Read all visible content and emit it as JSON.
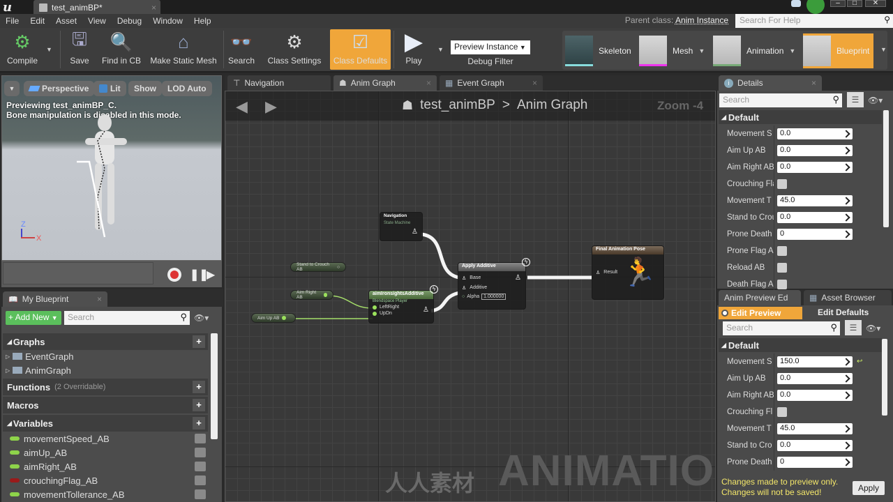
{
  "window": {
    "doc_tab": "test_animBP*",
    "parent_class_label": "Parent class:",
    "parent_class_value": "Anim Instance",
    "help_search_placeholder": "Search For Help"
  },
  "menu": [
    "File",
    "Edit",
    "Asset",
    "View",
    "Debug",
    "Window",
    "Help"
  ],
  "toolbar": {
    "compile": "Compile",
    "save": "Save",
    "find_in_cb": "Find in CB",
    "make_static_mesh": "Make Static Mesh",
    "search": "Search",
    "class_settings": "Class Settings",
    "class_defaults": "Class Defaults",
    "play": "Play",
    "debug_select": "Preview Instance",
    "debug_filter": "Debug Filter"
  },
  "asset_modes": [
    "Skeleton",
    "Mesh",
    "Animation",
    "Blueprint"
  ],
  "viewport": {
    "buttons": [
      "Perspective",
      "Lit",
      "Show",
      "LOD Auto"
    ],
    "info_line1": "Previewing test_animBP_C.",
    "info_line2": "Bone manipulation is disabled in this mode.",
    "axis_z": "Z",
    "axis_x": "X"
  },
  "my_blueprint": {
    "tab": "My Blueprint",
    "add_new": "Add New",
    "search_placeholder": "Search",
    "graphs_header": "Graphs",
    "graphs": [
      "EventGraph",
      "AnimGraph"
    ],
    "functions_header": "Functions",
    "functions_note": "(2 Overridable)",
    "macros_header": "Macros",
    "variables_header": "Variables",
    "variables": [
      {
        "name": "movementSpeed_AB",
        "color": "#8ed34a"
      },
      {
        "name": "aimUp_AB",
        "color": "#8ed34a"
      },
      {
        "name": "aimRight_AB",
        "color": "#8ed34a"
      },
      {
        "name": "crouchingFlag_AB",
        "color": "#9a1a1a"
      },
      {
        "name": "movementTollerance_AB",
        "color": "#8ed34a"
      }
    ]
  },
  "graph": {
    "tabs": [
      "Navigation",
      "Anim Graph",
      "Event Graph"
    ],
    "breadcrumb_root": "test_animBP",
    "breadcrumb_sep": ">",
    "breadcrumb_leaf": "Anim Graph",
    "zoom": "Zoom -4",
    "nodes": {
      "navigation_title": "Navigation",
      "navigation_sub": "State Machine",
      "stand_to_crouch": "Stand to Crouch AB",
      "aim_right": "Aim Right AB",
      "aim_up": "Aim Up AB",
      "blendspace_title": "aimIronsightsAdditive",
      "blendspace_sub": "Blendspace Player",
      "blendspace_pin1": "LeftRight",
      "blendspace_pin2": "UpDn",
      "apply_title": "Apply Additive",
      "apply_base": "Base",
      "apply_additive": "Additive",
      "apply_alpha": "Alpha",
      "apply_alpha_value": "1.000000",
      "final_title": "Final Animation Pose",
      "final_result": "Result"
    },
    "watermark": "ANIMATION",
    "watermark_cn": "人人素材"
  },
  "details": {
    "tab": "Details",
    "search_placeholder": "Search",
    "category": "Default",
    "props": [
      {
        "label": "Movement S",
        "value": "0.0",
        "type": "num"
      },
      {
        "label": "Aim Up AB",
        "value": "0.0",
        "type": "num"
      },
      {
        "label": "Aim Right AB",
        "value": "0.0",
        "type": "num"
      },
      {
        "label": "Crouching Fla",
        "value": "",
        "type": "check"
      },
      {
        "label": "Movement T",
        "value": "45.0",
        "type": "num"
      },
      {
        "label": "Stand to Crou",
        "value": "0.0",
        "type": "num"
      },
      {
        "label": "Prone Death",
        "value": "0",
        "type": "num"
      },
      {
        "label": "Prone Flag A",
        "value": "",
        "type": "check"
      },
      {
        "label": "Reload AB",
        "value": "",
        "type": "check"
      },
      {
        "label": "Death Flag A",
        "value": "",
        "type": "check"
      }
    ]
  },
  "preview_editor": {
    "tabs": [
      "Anim Preview Ed",
      "Asset Browser"
    ],
    "edit_preview": "Edit Preview",
    "edit_defaults": "Edit Defaults",
    "search_placeholder": "Search",
    "category": "Default",
    "props": [
      {
        "label": "Movement S",
        "value": "150.0",
        "type": "num"
      },
      {
        "label": "Aim Up AB",
        "value": "0.0",
        "type": "num"
      },
      {
        "label": "Aim Right AB",
        "value": "0.0",
        "type": "num"
      },
      {
        "label": "Crouching Fl",
        "value": "",
        "type": "check"
      },
      {
        "label": "Movement T",
        "value": "45.0",
        "type": "num"
      },
      {
        "label": "Stand to Cro",
        "value": "0.0",
        "type": "num"
      },
      {
        "label": "Prone Death",
        "value": "0",
        "type": "num"
      }
    ],
    "changes_line1": "Changes made to preview only.",
    "changes_line2": "Changes will not be saved!",
    "apply": "Apply"
  },
  "colors": {
    "accent": "#f0a63a",
    "add_new": "#5bbf5c",
    "exec_green": "#9be25c"
  }
}
